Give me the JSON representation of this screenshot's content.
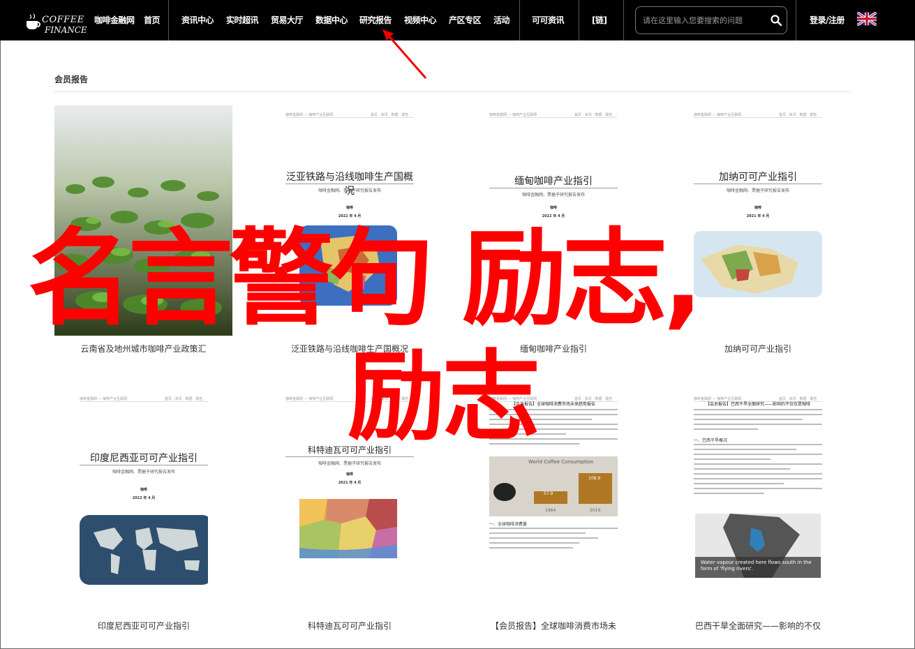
{
  "brand": {
    "line1": "COFFEE",
    "line2": "FINANCE"
  },
  "nav": {
    "items": [
      {
        "label": "咖啡金融网"
      },
      {
        "label": "首页"
      },
      {
        "label": "资讯中心"
      },
      {
        "label": "实时超讯"
      },
      {
        "label": "贸易大厅"
      },
      {
        "label": "数据中心"
      },
      {
        "label": "研究报告"
      },
      {
        "label": "视频中心"
      },
      {
        "label": "产区专区"
      },
      {
        "label": "活动"
      },
      {
        "label": "可可资讯"
      },
      {
        "label": "[链]"
      }
    ],
    "search_placeholder": "请在这里输入您要搜索的问题",
    "login": "登录/注册",
    "language_flag": "uk-flag-icon"
  },
  "section": {
    "title": "会员报告"
  },
  "colors": {
    "nav_bg": "#000000",
    "overlay_red": "#ff0000",
    "accent_orange": "#c78a2c"
  },
  "cards": [
    {
      "caption": "云南省及地州城市咖啡产业政策汇",
      "doc_title": "",
      "image": "coffee-seedlings-photo"
    },
    {
      "caption": "泛亚铁路与沿线咖啡生产国概况",
      "doc_title": "泛亚铁路与沿线咖啡生产国概况",
      "doc_sub": "咖啡金融网、票据子研究报告发布",
      "doc_name": "咖啡",
      "doc_date": "2022 年 4 月",
      "image": "asia-map-icon"
    },
    {
      "caption": "缅甸咖啡产业指引",
      "doc_title": "缅甸咖啡产业指引",
      "doc_sub": "咖啡金融网、票据子研究报告发布",
      "doc_name": "咖啡",
      "doc_date": "2022 年 4 月",
      "image": ""
    },
    {
      "caption": "加纳可可产业指引",
      "doc_title": "加纳可可产业指引",
      "doc_sub": "咖啡金融网、票据子研究报告发布",
      "doc_name": "咖啡",
      "doc_date": "2021 年 4 月",
      "image": "ghana-map-icon"
    },
    {
      "caption": "印度尼西亚可可产业指引",
      "doc_title": "印度尼西亚可可产业指引",
      "doc_sub": "咖啡金融网、票据子研究报告发布",
      "doc_name": "咖啡",
      "doc_date": "2022 年 4 月",
      "image": "world-map-icon"
    },
    {
      "caption": "科特迪瓦可可产业指引",
      "doc_title": "科特迪瓦可可产业指引",
      "doc_sub": "咖啡金融网、票据子研究报告发布",
      "doc_name": "咖啡",
      "doc_date": "2021 年 4 月",
      "image": "ivory-coast-map-icon"
    },
    {
      "caption": "【会员报告】全球咖啡消费市场未",
      "doc_title": "【会员报告】全球咖啡消费市场未来趋势报告",
      "chart_title": "World Coffee Consumption",
      "bar_values": [
        "57.9",
        "108.9"
      ],
      "bar_years": [
        "1964",
        "2019"
      ],
      "section_label": "一、全球咖啡消费量"
    },
    {
      "caption": "巴西干旱全面研究——影响的不仅",
      "doc_title": "【会员报告】巴西干旱全面研究——影响的不仅仅是咖啡",
      "section_label": "一、巴西干旱概况",
      "image_caption": "Water vapour created here flows south in the form of 'flying rivers'."
    }
  ],
  "overlay": {
    "line1": "名言警句 励志,",
    "line2": "励志"
  }
}
